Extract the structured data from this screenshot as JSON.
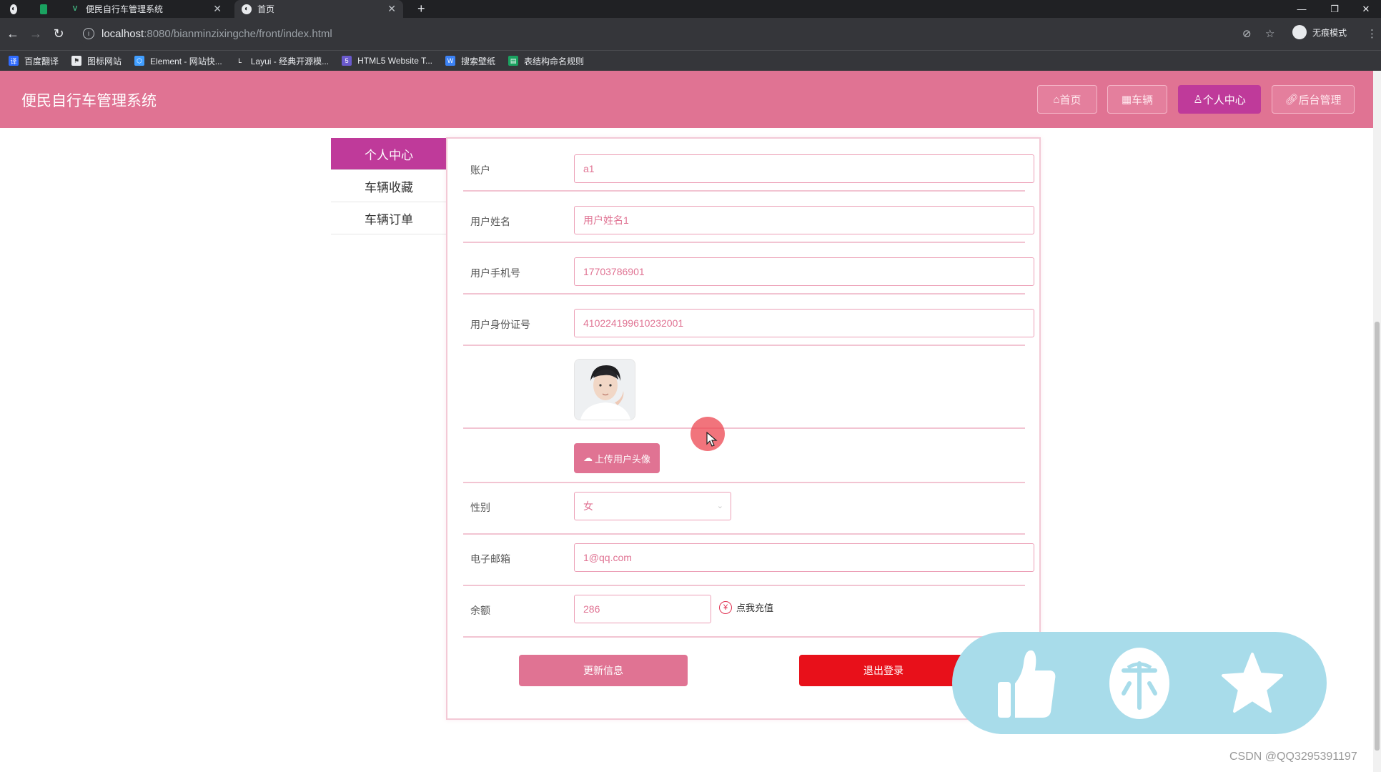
{
  "browser": {
    "tabs": [
      {
        "label": "",
        "icon": "chrome-globe-icon"
      },
      {
        "label": "",
        "icon": "green-app-icon"
      },
      {
        "label": "便民自行车管理系统",
        "icon": "vue-icon"
      },
      {
        "label": "首页",
        "icon": "globe-icon"
      }
    ],
    "new_tab": "+",
    "url_host": "localhost",
    "url_path": ":8080/bianminzixingche/front/index.html",
    "profile_label": "无痕模式",
    "bookmarks": [
      {
        "label": "百度翻译",
        "icon": "baidu-translate-icon",
        "color": "#2f6bff"
      },
      {
        "label": "图标网站",
        "icon": "flag-icon",
        "color": "#333333"
      },
      {
        "label": "Element - 网站快...",
        "icon": "element-icon",
        "color": "#409eff"
      },
      {
        "label": "Layui - 经典开源模...",
        "icon": "layui-icon",
        "color": "#555555"
      },
      {
        "label": "HTML5 Website T...",
        "icon": "html5-icon",
        "color": "#6a5acd"
      },
      {
        "label": "搜索壁纸",
        "icon": "wallpaper-icon",
        "color": "#3b82f6"
      },
      {
        "label": "表结构命名规则",
        "icon": "sheet-icon",
        "color": "#1aa260"
      }
    ]
  },
  "app": {
    "title": "便民自行车管理系统",
    "nav": [
      {
        "label": "首页",
        "icon": "home-icon",
        "active": false
      },
      {
        "label": "车辆",
        "icon": "grid-icon",
        "active": false
      },
      {
        "label": "个人中心",
        "icon": "user-icon",
        "active": true
      },
      {
        "label": "后台管理",
        "icon": "link-icon",
        "active": false
      }
    ],
    "accent": "#e07393",
    "active_color": "#bf3a9a"
  },
  "side_menu": {
    "items": [
      {
        "label": "个人中心",
        "active": true
      },
      {
        "label": "车辆收藏",
        "active": false
      },
      {
        "label": "车辆订单",
        "active": false
      }
    ]
  },
  "form": {
    "account": {
      "label": "账户",
      "value": "a1"
    },
    "name": {
      "label": "用户姓名",
      "value": "用户姓名1"
    },
    "phone": {
      "label": "用户手机号",
      "value": "17703786901"
    },
    "id_card": {
      "label": "用户身份证号",
      "value": "410224199610232001"
    },
    "avatar": {
      "alt": "用户头像"
    },
    "upload_label": "上传用户头像",
    "gender": {
      "label": "性别",
      "value": "女"
    },
    "email": {
      "label": "电子邮箱",
      "value": "1@qq.com"
    },
    "balance": {
      "label": "余额",
      "value": "286",
      "recharge_label": "点我充值",
      "recharge_symbol": "¥"
    },
    "update_button": "更新信息",
    "logout_button": "退出登录",
    "logout_color": "#e8101a"
  },
  "overlay": {
    "watermark": "CSDN @QQ3295391197",
    "social_icons": [
      "thumbs-up-icon",
      "coin-icon",
      "star-icon"
    ]
  }
}
